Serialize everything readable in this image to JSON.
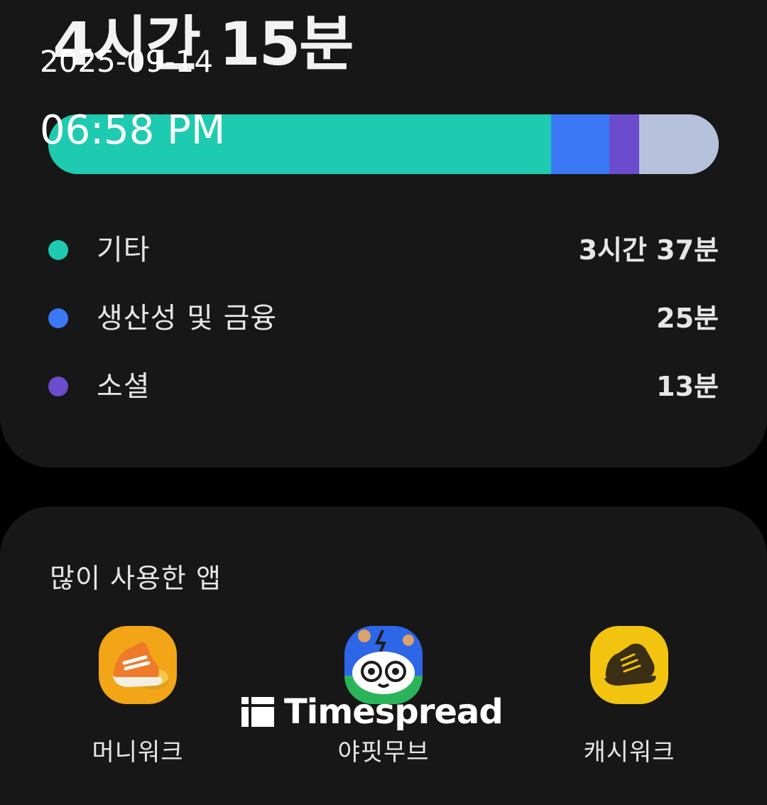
{
  "summary": {
    "total_time": "4시간 15분"
  },
  "usage_bar": {
    "segments": [
      {
        "category": "기타",
        "color": "#1ecbb0",
        "minutes": 217
      },
      {
        "category": "생산성 및 금융",
        "color": "#3a78f5",
        "minutes": 25
      },
      {
        "category": "소셜",
        "color": "#6a4ccc",
        "minutes": 13
      },
      {
        "category": "remaining",
        "color": "#b6c2dc",
        "minutes": 30
      }
    ]
  },
  "legend": [
    {
      "label": "기타",
      "value": "3시간 37분",
      "color": "#1ecbb0"
    },
    {
      "label": "생산성 및 금융",
      "value": "25분",
      "color": "#3a78f5"
    },
    {
      "label": "소셜",
      "value": "13분",
      "color": "#6a4ccc"
    }
  ],
  "top_apps": {
    "title": "많이 사용한 앱",
    "apps": [
      {
        "name": "머니워크",
        "icon": "sneaker-coin-icon"
      },
      {
        "name": "야핏무브",
        "icon": "yafit-character-icon"
      },
      {
        "name": "캐시워크",
        "icon": "cashwalk-shoe-icon"
      }
    ]
  },
  "overlay": {
    "date": "2025-09-14",
    "time": "06:58 PM"
  },
  "watermark": {
    "text": "Timespread"
  }
}
